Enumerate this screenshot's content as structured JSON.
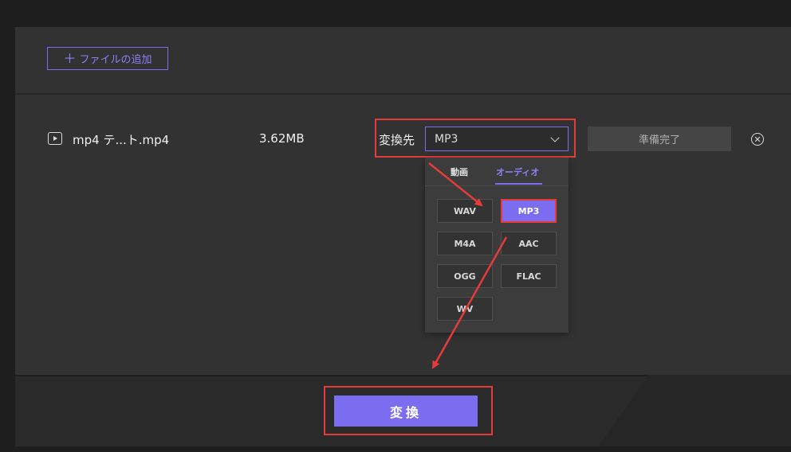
{
  "toolbar": {
    "add_file_label": "ファイルの追加",
    "add_icon": "plus-icon"
  },
  "file": {
    "name": "mp4 テ...ト.mp4",
    "size": "3.62MB",
    "target_label": "変換先",
    "selected_format": "MP3",
    "status": "準備完了",
    "play_icon": "video-play-icon",
    "remove_icon": "close-circle-icon"
  },
  "dropdown": {
    "tabs": [
      "動画",
      "オーディオ"
    ],
    "active_tab": "オーディオ",
    "formats": [
      "WAV",
      "MP3",
      "M4A",
      "AAC",
      "OGG",
      "FLAC",
      "WV"
    ],
    "selected": "MP3"
  },
  "bottom": {
    "convert_label": "変換"
  },
  "colors": {
    "accent": "#7b6cf0",
    "highlight": "#e43b3b",
    "background": "#323232"
  }
}
